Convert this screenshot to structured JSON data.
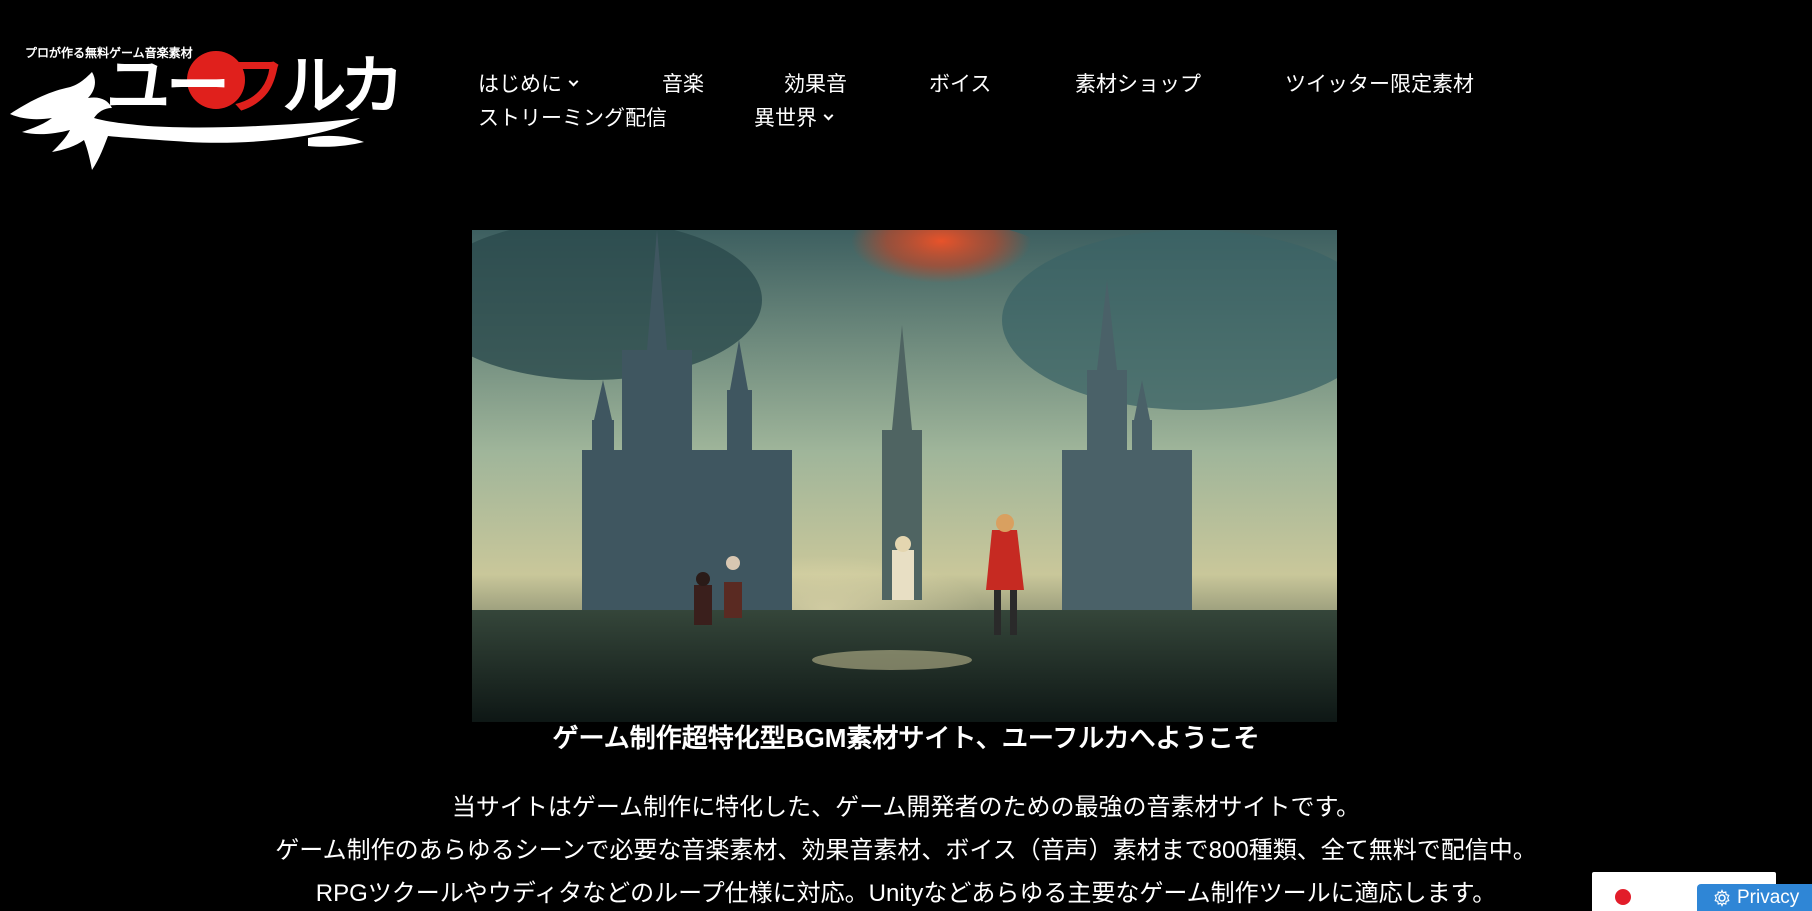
{
  "logo": {
    "tagline": "プロが作る無料ゲーム音楽素材",
    "word_prefix": "ユー",
    "word_red": "フ",
    "word_suffix": "ルカ"
  },
  "nav": {
    "row1": [
      {
        "label": "はじめに",
        "dropdown": true
      },
      {
        "label": "音楽",
        "dropdown": false
      },
      {
        "label": "効果音",
        "dropdown": false
      },
      {
        "label": "ボイス",
        "dropdown": false
      },
      {
        "label": "素材ショップ",
        "dropdown": false
      },
      {
        "label": "ツイッター限定素材",
        "dropdown": false
      }
    ],
    "row2": [
      {
        "label": "ストリーミング配信",
        "dropdown": false
      },
      {
        "label": "異世界",
        "dropdown": true
      }
    ]
  },
  "main": {
    "headline": "ゲーム制作超特化型BGM素材サイト、ユーフルカへようこそ",
    "intro": [
      "当サイトはゲーム制作に特化した、ゲーム開発者のための最強の音素材サイトです。",
      "ゲーム制作のあらゆるシーンで必要な音楽素材、効果音素材、ボイス（音声）素材まで800種類、全て無料で配信中。",
      "RPGツクールやウディタなどのループ仕様に対応。Unityなどあらゆる主要なゲーム制作ツールに適応します。"
    ]
  },
  "privacy": {
    "label": "Privacy"
  },
  "colors": {
    "background": "#000000",
    "logo_accent": "#e0201c",
    "privacy_button": "#2f86d6",
    "flag_red": "#e21d2a"
  }
}
